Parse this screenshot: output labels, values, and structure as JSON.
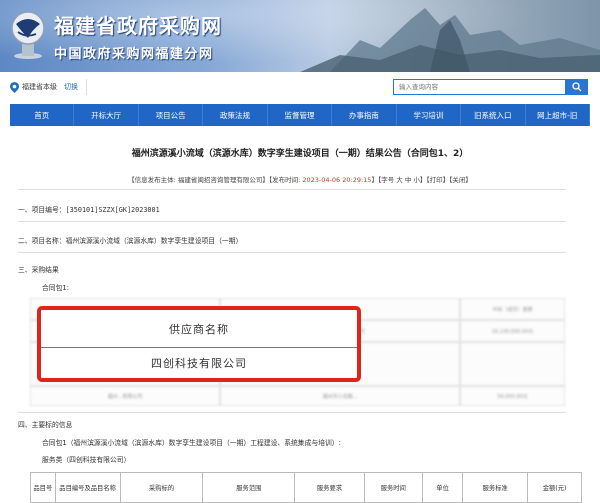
{
  "banner": {
    "title": "福建省政府采购网",
    "subtitle": "中国政府采购网福建分网"
  },
  "region": {
    "name": "福建省本级",
    "switch_label": "切换"
  },
  "search": {
    "placeholder": "输入查询内容"
  },
  "nav": {
    "items": [
      {
        "label": "首页"
      },
      {
        "label": "开标大厅"
      },
      {
        "label": "项目公告"
      },
      {
        "label": "政策法规"
      },
      {
        "label": "监督管理"
      },
      {
        "label": "办事指南"
      },
      {
        "label": "学习培训"
      },
      {
        "label": "旧系统入口"
      },
      {
        "label": "网上超市-旧"
      }
    ]
  },
  "article": {
    "title": "福州滨源溪小流域（滨源水库）数字孪生建设项目（一期）结果公告（合同包1、2）",
    "meta_prefix": "【信息发布主体: ",
    "meta_publisher": "福建省闽招咨询管理有限公司",
    "meta_mid": "】【发布时间: ",
    "meta_date": "2023-04-06 20:29:15",
    "meta_suffix": "】【字号 大 中 小】【打印】【关闭】",
    "sec1": "一、项目编号：[350101]SZZX[GK]2023001",
    "sec2": "二、项目名称：福州滨源溪小流域（滨源水库）数字孪生建设项目（一期）",
    "sec3": "三、采购结果",
    "sec3_sub": "合同包1:",
    "sec4": "四、主要标的信息",
    "sec4_line1": "合同包1（福州滨源溪小流域（滨源水库）数字孪生建设项目（一期）工程建设、系统集成与培训）:",
    "sec4_line2": "服务类（四创科技有限公司）"
  },
  "highlight": {
    "header": "供应商名称",
    "value": "四创科技有限公司"
  },
  "blurred_table": {
    "amount_label": "中标（成交）金额",
    "amount1": "16,100,000.00元",
    "amount2": "56,000.00元",
    "row1_addr": "福州市鼓楼区...路...号",
    "row2_name": "福州...有限公司",
    "row2_addr": "福州市小龙路..."
  },
  "goods_table": {
    "headers": [
      "品目号",
      "品目编号及品目名称",
      "采购标的",
      "服务范围",
      "服务要求",
      "服务时间",
      "单位",
      "服务标准",
      "金额(元)"
    ]
  },
  "colors": {
    "nav_bg": "#2066c7",
    "highlight_border": "#e0231b",
    "date": "#c0392b"
  }
}
